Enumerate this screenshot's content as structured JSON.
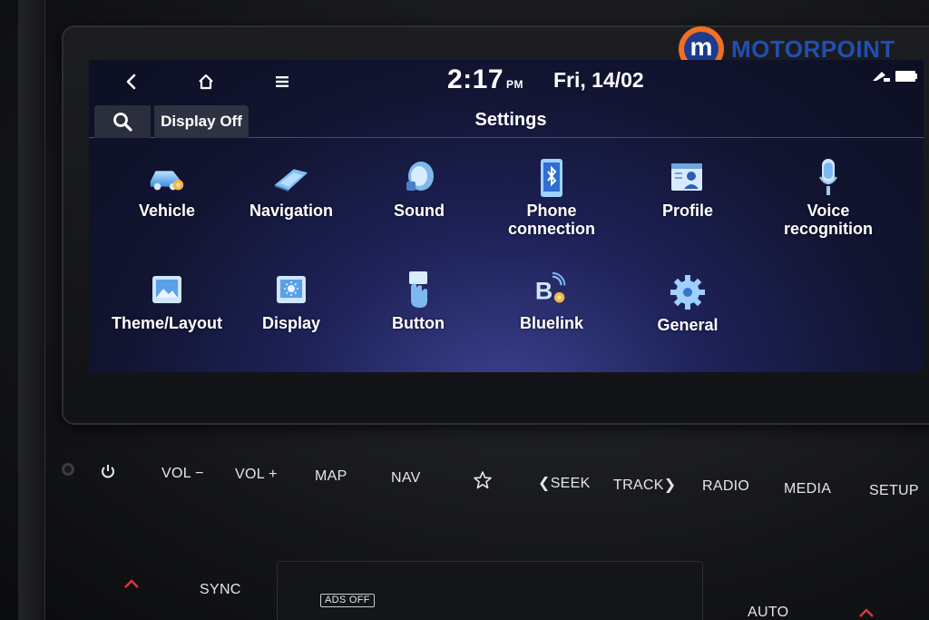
{
  "watermark": {
    "brand": "MOTORPOINT",
    "logo_letter": "m"
  },
  "statusbar": {
    "time": "2:17",
    "ampm": "PM",
    "date": "Fri, 14/02",
    "icons": [
      "back-icon",
      "home-icon",
      "menu-icon",
      "phone-status-icon",
      "battery-icon"
    ]
  },
  "toolbar": {
    "search_icon": "search-icon",
    "display_off_label": "Display Off",
    "title": "Settings"
  },
  "settings": [
    {
      "label": "Vehicle",
      "icon": "vehicle-icon"
    },
    {
      "label": "Navigation",
      "icon": "navigation-icon"
    },
    {
      "label": "Sound",
      "icon": "sound-icon"
    },
    {
      "label": "Phone\nconnection",
      "line1": "Phone",
      "line2": "connection",
      "icon": "phone-connection-icon"
    },
    {
      "label": "Profile",
      "icon": "profile-icon"
    },
    {
      "label": "Voice\nrecognition",
      "line1": "Voice",
      "line2": "recognition",
      "icon": "microphone-icon"
    },
    {
      "label": "Theme/Layout",
      "icon": "theme-layout-icon"
    },
    {
      "label": "Display",
      "icon": "display-icon"
    },
    {
      "label": "Button",
      "icon": "button-icon"
    },
    {
      "label": "Bluelink",
      "icon": "bluelink-icon"
    },
    {
      "label": "General",
      "icon": "gear-icon"
    }
  ],
  "hardware_buttons": {
    "power": "⏻",
    "vol_down": "VOL −",
    "vol_up": "VOL +",
    "map": "MAP",
    "nav": "NAV",
    "favorite": "☆",
    "seek": "❮SEEK",
    "track": "TRACK❯",
    "radio": "RADIO",
    "media": "MEDIA",
    "setup": "SETUP",
    "sync": "SYNC",
    "ads_off": "ADS OFF",
    "auto": "AUTO"
  },
  "colors": {
    "screen_bg": "#121532",
    "accent_blue": "#4aa8ff",
    "brand_orange": "#f36f21",
    "brand_blue": "#1f4fb3",
    "indicator_red": "#e0343b"
  }
}
